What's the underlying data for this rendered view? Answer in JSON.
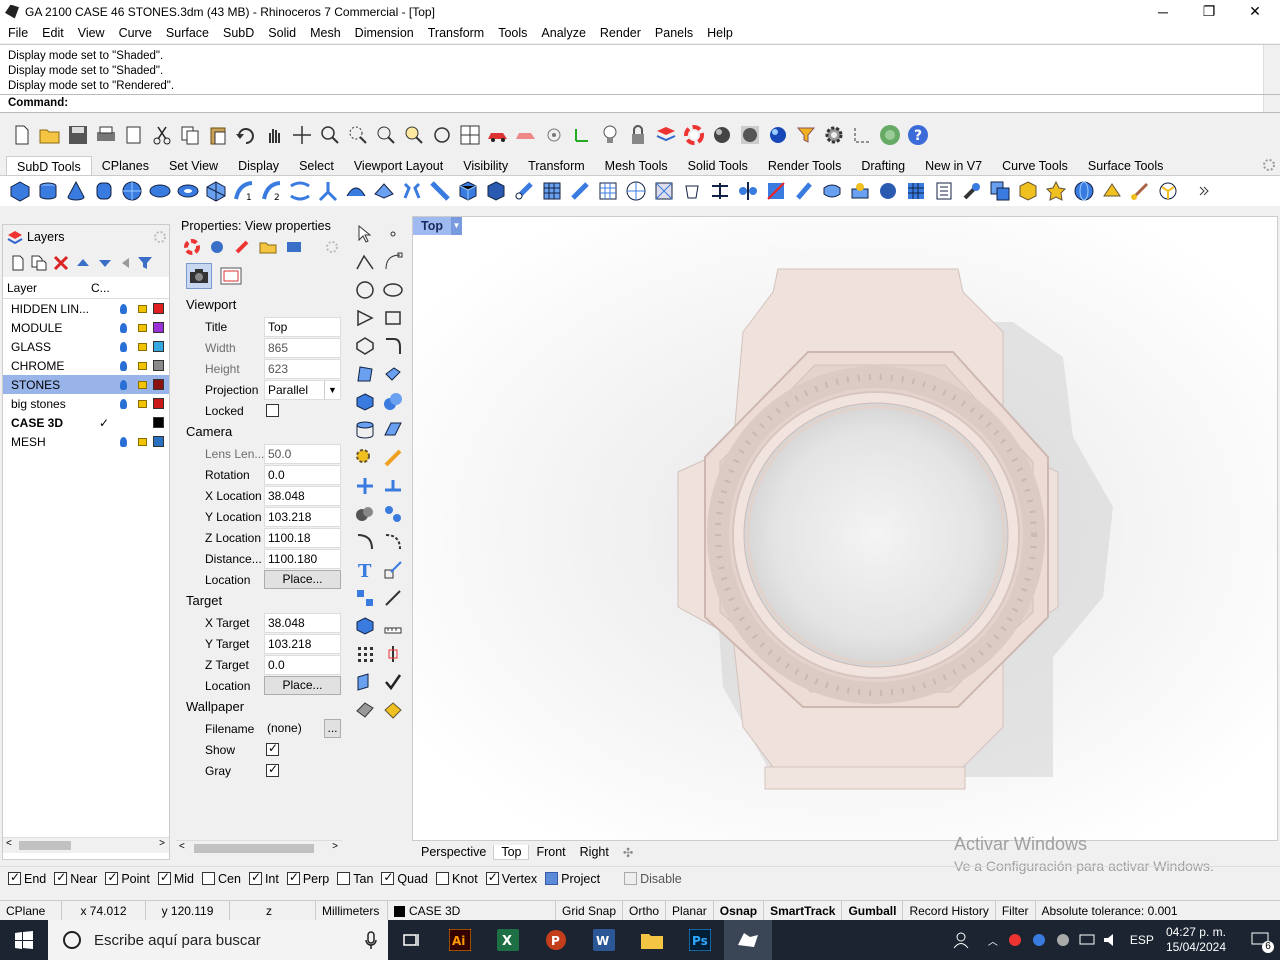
{
  "window": {
    "title": "GA 2100 CASE 46 STONES.3dm (43 MB) - Rhinoceros 7 Commercial - [Top]",
    "min": "─",
    "max": "❐",
    "close": "✕"
  },
  "menu": [
    "File",
    "Edit",
    "View",
    "Curve",
    "Surface",
    "SubD",
    "Solid",
    "Mesh",
    "Dimension",
    "Transform",
    "Tools",
    "Analyze",
    "Render",
    "Panels",
    "Help"
  ],
  "command_history": [
    "Display mode set to \"Shaded\".",
    "Display mode set to \"Shaded\".",
    "Display mode set to \"Rendered\"."
  ],
  "command_prompt": "Command:",
  "toolbar_tabs": [
    "SubD Tools",
    "CPlanes",
    "Set View",
    "Display",
    "Select",
    "Viewport Layout",
    "Visibility",
    "Transform",
    "Mesh Tools",
    "Solid Tools",
    "Render Tools",
    "Drafting",
    "New in V7",
    "Curve Tools",
    "Surface Tools"
  ],
  "layers": {
    "title": "Layers",
    "col_layer": "Layer",
    "col_current": "C...",
    "items": [
      {
        "name": "HIDDEN LIN...",
        "color": "#e02020",
        "current": ""
      },
      {
        "name": "MODULE",
        "color": "#9b30d9",
        "current": ""
      },
      {
        "name": "GLASS",
        "color": "#34a8e0",
        "current": ""
      },
      {
        "name": "CHROME",
        "color": "#8a8a8a",
        "current": ""
      },
      {
        "name": "STONES",
        "color": "#8b1010",
        "current": ""
      },
      {
        "name": "big stones",
        "color": "#c81818",
        "current": ""
      },
      {
        "name": "CASE 3D",
        "color": "#000000",
        "current": "✓"
      },
      {
        "name": "MESH",
        "color": "#2870c0",
        "current": ""
      }
    ]
  },
  "properties": {
    "title": "Properties: View properties",
    "viewport": {
      "section": "Viewport",
      "title_label": "Title",
      "title": "Top",
      "width_label": "Width",
      "width": "865",
      "height_label": "Height",
      "height": "623",
      "projection_label": "Projection",
      "projection": "Parallel",
      "locked_label": "Locked"
    },
    "camera": {
      "section": "Camera",
      "lens_label": "Lens Len...",
      "lens": "50.0",
      "rotation_label": "Rotation",
      "rotation": "0.0",
      "xloc_label": "X Location",
      "xloc": "38.048",
      "yloc_label": "Y Location",
      "yloc": "103.218",
      "zloc_label": "Z Location",
      "zloc": "1100.18",
      "dist_label": "Distance...",
      "dist": "1100.180",
      "location_label": "Location",
      "place": "Place..."
    },
    "target": {
      "section": "Target",
      "xt_label": "X Target",
      "xt": "38.048",
      "yt_label": "Y Target",
      "yt": "103.218",
      "zt_label": "Z Target",
      "zt": "0.0",
      "location_label": "Location",
      "place": "Place..."
    },
    "wallpaper": {
      "section": "Wallpaper",
      "filename_label": "Filename",
      "filename": "(none)",
      "browse": "...",
      "show_label": "Show",
      "gray_label": "Gray"
    }
  },
  "viewport": {
    "name": "Top",
    "arrow": "▼"
  },
  "viewport_tabs": [
    "Perspective",
    "Top",
    "Front",
    "Right",
    "✣"
  ],
  "watermark": {
    "line1": "Activar Windows",
    "line2": "Ve a Configuración para activar Windows."
  },
  "osnaps": [
    {
      "label": "End",
      "on": true
    },
    {
      "label": "Near",
      "on": true
    },
    {
      "label": "Point",
      "on": true
    },
    {
      "label": "Mid",
      "on": true
    },
    {
      "label": "Cen",
      "on": false
    },
    {
      "label": "Int",
      "on": true
    },
    {
      "label": "Perp",
      "on": true
    },
    {
      "label": "Tan",
      "on": false
    },
    {
      "label": "Quad",
      "on": true
    },
    {
      "label": "Knot",
      "on": false
    },
    {
      "label": "Vertex",
      "on": true
    },
    {
      "label": "Project",
      "on": false
    },
    {
      "label": "Disable",
      "on": false
    }
  ],
  "status": {
    "cplane": "CPlane",
    "x": "x 74.012",
    "y": "y 120.119",
    "z": "z",
    "units": "Millimeters",
    "layer": "CASE 3D",
    "gridsnap": "Grid Snap",
    "ortho": "Ortho",
    "planar": "Planar",
    "osnap": "Osnap",
    "smarttrack": "SmartTrack",
    "gumball": "Gumball",
    "history": "Record History",
    "filter": "Filter",
    "tolerance": "Absolute tolerance: 0.001"
  },
  "taskbar": {
    "search": "Escribe aquí para buscar",
    "lang": "ESP",
    "time": "04:27 p. m.",
    "date": "15/04/2024",
    "notif": "6"
  }
}
